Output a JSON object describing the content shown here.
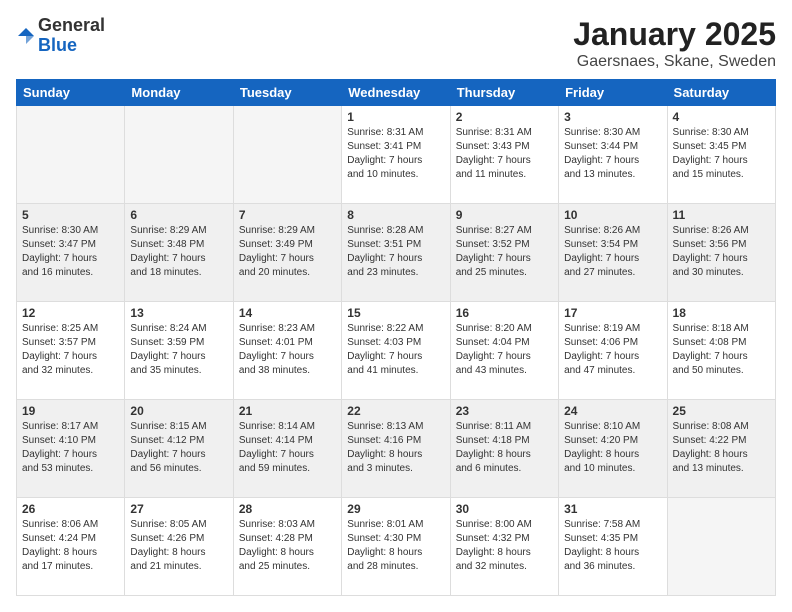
{
  "logo": {
    "general": "General",
    "blue": "Blue"
  },
  "title": "January 2025",
  "subtitle": "Gaersnaes, Skane, Sweden",
  "headers": [
    "Sunday",
    "Monday",
    "Tuesday",
    "Wednesday",
    "Thursday",
    "Friday",
    "Saturday"
  ],
  "weeks": [
    [
      {
        "day": "",
        "info": ""
      },
      {
        "day": "",
        "info": ""
      },
      {
        "day": "",
        "info": ""
      },
      {
        "day": "1",
        "info": "Sunrise: 8:31 AM\nSunset: 3:41 PM\nDaylight: 7 hours\nand 10 minutes."
      },
      {
        "day": "2",
        "info": "Sunrise: 8:31 AM\nSunset: 3:43 PM\nDaylight: 7 hours\nand 11 minutes."
      },
      {
        "day": "3",
        "info": "Sunrise: 8:30 AM\nSunset: 3:44 PM\nDaylight: 7 hours\nand 13 minutes."
      },
      {
        "day": "4",
        "info": "Sunrise: 8:30 AM\nSunset: 3:45 PM\nDaylight: 7 hours\nand 15 minutes."
      }
    ],
    [
      {
        "day": "5",
        "info": "Sunrise: 8:30 AM\nSunset: 3:47 PM\nDaylight: 7 hours\nand 16 minutes."
      },
      {
        "day": "6",
        "info": "Sunrise: 8:29 AM\nSunset: 3:48 PM\nDaylight: 7 hours\nand 18 minutes."
      },
      {
        "day": "7",
        "info": "Sunrise: 8:29 AM\nSunset: 3:49 PM\nDaylight: 7 hours\nand 20 minutes."
      },
      {
        "day": "8",
        "info": "Sunrise: 8:28 AM\nSunset: 3:51 PM\nDaylight: 7 hours\nand 23 minutes."
      },
      {
        "day": "9",
        "info": "Sunrise: 8:27 AM\nSunset: 3:52 PM\nDaylight: 7 hours\nand 25 minutes."
      },
      {
        "day": "10",
        "info": "Sunrise: 8:26 AM\nSunset: 3:54 PM\nDaylight: 7 hours\nand 27 minutes."
      },
      {
        "day": "11",
        "info": "Sunrise: 8:26 AM\nSunset: 3:56 PM\nDaylight: 7 hours\nand 30 minutes."
      }
    ],
    [
      {
        "day": "12",
        "info": "Sunrise: 8:25 AM\nSunset: 3:57 PM\nDaylight: 7 hours\nand 32 minutes."
      },
      {
        "day": "13",
        "info": "Sunrise: 8:24 AM\nSunset: 3:59 PM\nDaylight: 7 hours\nand 35 minutes."
      },
      {
        "day": "14",
        "info": "Sunrise: 8:23 AM\nSunset: 4:01 PM\nDaylight: 7 hours\nand 38 minutes."
      },
      {
        "day": "15",
        "info": "Sunrise: 8:22 AM\nSunset: 4:03 PM\nDaylight: 7 hours\nand 41 minutes."
      },
      {
        "day": "16",
        "info": "Sunrise: 8:20 AM\nSunset: 4:04 PM\nDaylight: 7 hours\nand 43 minutes."
      },
      {
        "day": "17",
        "info": "Sunrise: 8:19 AM\nSunset: 4:06 PM\nDaylight: 7 hours\nand 47 minutes."
      },
      {
        "day": "18",
        "info": "Sunrise: 8:18 AM\nSunset: 4:08 PM\nDaylight: 7 hours\nand 50 minutes."
      }
    ],
    [
      {
        "day": "19",
        "info": "Sunrise: 8:17 AM\nSunset: 4:10 PM\nDaylight: 7 hours\nand 53 minutes."
      },
      {
        "day": "20",
        "info": "Sunrise: 8:15 AM\nSunset: 4:12 PM\nDaylight: 7 hours\nand 56 minutes."
      },
      {
        "day": "21",
        "info": "Sunrise: 8:14 AM\nSunset: 4:14 PM\nDaylight: 7 hours\nand 59 minutes."
      },
      {
        "day": "22",
        "info": "Sunrise: 8:13 AM\nSunset: 4:16 PM\nDaylight: 8 hours\nand 3 minutes."
      },
      {
        "day": "23",
        "info": "Sunrise: 8:11 AM\nSunset: 4:18 PM\nDaylight: 8 hours\nand 6 minutes."
      },
      {
        "day": "24",
        "info": "Sunrise: 8:10 AM\nSunset: 4:20 PM\nDaylight: 8 hours\nand 10 minutes."
      },
      {
        "day": "25",
        "info": "Sunrise: 8:08 AM\nSunset: 4:22 PM\nDaylight: 8 hours\nand 13 minutes."
      }
    ],
    [
      {
        "day": "26",
        "info": "Sunrise: 8:06 AM\nSunset: 4:24 PM\nDaylight: 8 hours\nand 17 minutes."
      },
      {
        "day": "27",
        "info": "Sunrise: 8:05 AM\nSunset: 4:26 PM\nDaylight: 8 hours\nand 21 minutes."
      },
      {
        "day": "28",
        "info": "Sunrise: 8:03 AM\nSunset: 4:28 PM\nDaylight: 8 hours\nand 25 minutes."
      },
      {
        "day": "29",
        "info": "Sunrise: 8:01 AM\nSunset: 4:30 PM\nDaylight: 8 hours\nand 28 minutes."
      },
      {
        "day": "30",
        "info": "Sunrise: 8:00 AM\nSunset: 4:32 PM\nDaylight: 8 hours\nand 32 minutes."
      },
      {
        "day": "31",
        "info": "Sunrise: 7:58 AM\nSunset: 4:35 PM\nDaylight: 8 hours\nand 36 minutes."
      },
      {
        "day": "",
        "info": ""
      }
    ]
  ]
}
